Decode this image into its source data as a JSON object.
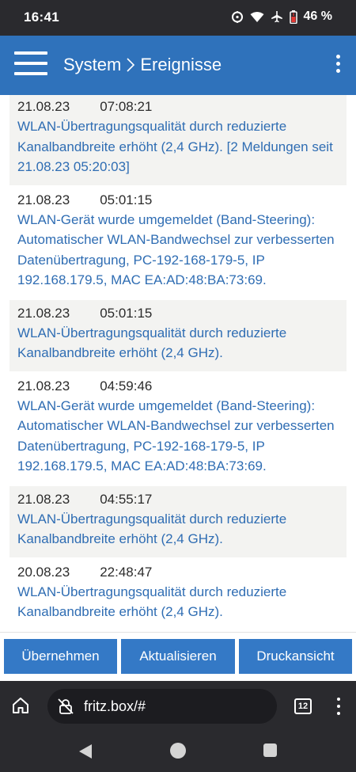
{
  "status_bar": {
    "time": "16:41",
    "battery_percent": "46 %",
    "icons": [
      "alarm-icon",
      "wifi-icon",
      "airplane-icon",
      "battery-icon"
    ]
  },
  "header": {
    "breadcrumb_parent": "System",
    "breadcrumb_separator": ">",
    "breadcrumb_current": "Ereignisse",
    "background_color": "#2f72bb"
  },
  "events": [
    {
      "date": "21.08.23",
      "time": "07:08:21",
      "message": "WLAN-Übertragungsqualität durch reduzierte Kanalbandbreite erhöht (2,4 GHz). [2 Meldungen seit 21.08.23 05:20:03]"
    },
    {
      "date": "21.08.23",
      "time": "05:01:15",
      "message": "WLAN-Gerät wurde umgemeldet (Band-Steering): Automatischer WLAN-Bandwechsel zur verbesserten Datenübertragung, PC-192-168-179-5, IP 192.168.179.5, MAC EA:AD:48:BA:73:69."
    },
    {
      "date": "21.08.23",
      "time": "05:01:15",
      "message": "WLAN-Übertragungsqualität durch reduzierte Kanalbandbreite erhöht (2,4 GHz)."
    },
    {
      "date": "21.08.23",
      "time": "04:59:46",
      "message": "WLAN-Gerät wurde umgemeldet (Band-Steering): Automatischer WLAN-Bandwechsel zur verbesserten Datenübertragung, PC-192-168-179-5, IP 192.168.179.5, MAC EA:AD:48:BA:73:69."
    },
    {
      "date": "21.08.23",
      "time": "04:55:17",
      "message": "WLAN-Übertragungsqualität durch reduzierte Kanalbandbreite erhöht (2,4 GHz)."
    },
    {
      "date": "20.08.23",
      "time": "22:48:47",
      "message": "WLAN-Übertragungsqualität durch reduzierte Kanalbandbreite erhöht (2,4 GHz)."
    }
  ],
  "actions": {
    "apply_label": "Übernehmen",
    "refresh_label": "Aktualisieren",
    "print_label": "Druckansicht",
    "button_color": "#3479c6"
  },
  "browser": {
    "url": "fritz.box/#",
    "tab_count": "12"
  }
}
